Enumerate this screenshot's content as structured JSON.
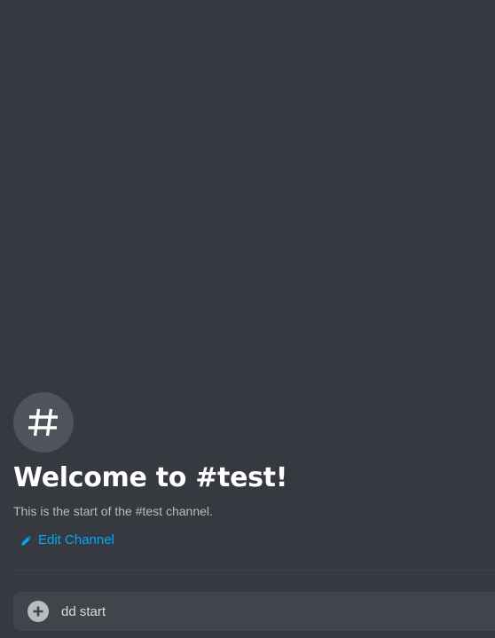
{
  "channel": {
    "icon": "hash-icon",
    "welcome_title": "Welcome to #test!",
    "welcome_description": "This is the start of the #test channel.",
    "edit_channel_label": "Edit Channel",
    "edit_icon": "pencil-icon"
  },
  "composer": {
    "value": "dd start",
    "attach_icon": "plus-circle-icon"
  },
  "colors": {
    "background": "#36393f",
    "hash_circle": "#4f545c",
    "title": "#ffffff",
    "description": "#b9bbbe",
    "link": "#00a8fc",
    "composer_background": "#40444b",
    "divider": "#3f4248"
  }
}
